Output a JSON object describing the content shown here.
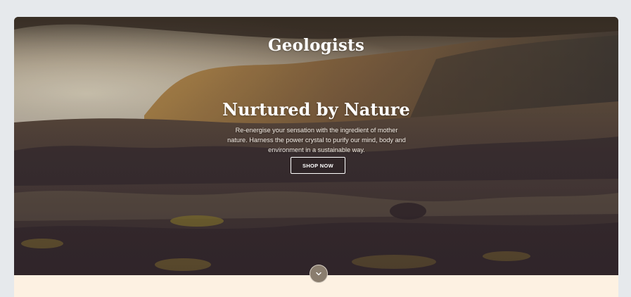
{
  "header": {
    "brand": "Geologists"
  },
  "hero": {
    "headline": "Nurtured by Nature",
    "subtitle": "Re-energise your sensation with the ingredient of mother nature. Harness the power crystal to purify our mind, body and environment in a sustainable way.",
    "cta_label": "SHOP NOW",
    "background": "landscape-photo"
  },
  "scroll": {
    "icon": "chevron-down-icon"
  },
  "colors": {
    "page_bg": "#e6e9ec",
    "section_bg": "#fdf1e2",
    "scroll_button": "#8a7d6e"
  }
}
